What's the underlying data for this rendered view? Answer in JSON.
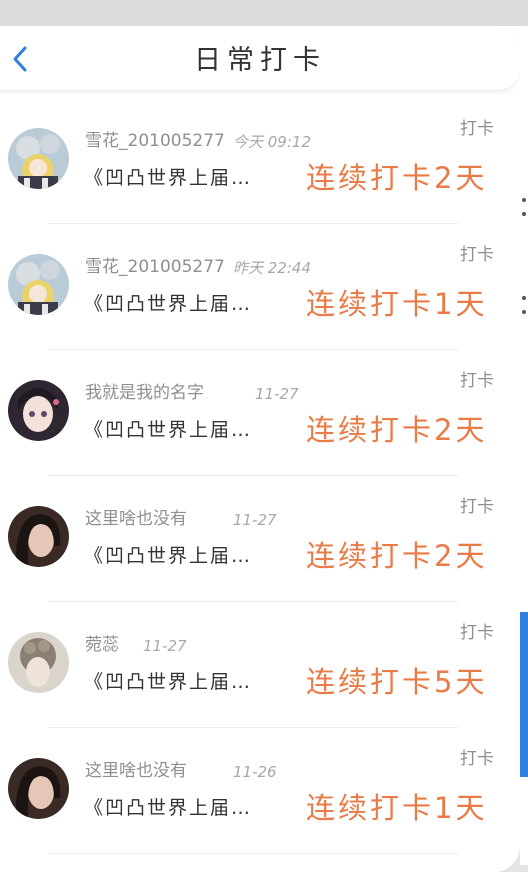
{
  "header": {
    "title": "日常打卡",
    "back_icon": "chevron-left-icon"
  },
  "colors": {
    "accent_blue": "#2f80e0",
    "streak_orange": "#e87b46",
    "meta_gray": "#8f8f8f"
  },
  "entries": [
    {
      "avatar": "anime-character-avatar",
      "name": "雪花_201005277",
      "time": "今天 09:12",
      "topic": "《凹凸世界上届…",
      "action": "打卡",
      "streak": "连续打卡2天"
    },
    {
      "avatar": "anime-character-avatar",
      "name": "雪花_201005277",
      "time": "昨天 22:44",
      "topic": "《凹凸世界上届…",
      "action": "打卡",
      "streak": "连续打卡1天"
    },
    {
      "avatar": "anime-girl-avatar",
      "name": "我就是我的名字",
      "time": "11-27",
      "topic": "《凹凸世界上届…",
      "action": "打卡",
      "streak": "连续打卡2天"
    },
    {
      "avatar": "dark-hair-photo-avatar",
      "name": "这里啥也没有",
      "time": "11-27",
      "topic": "《凹凸世界上届…",
      "action": "打卡",
      "streak": "连续打卡2天"
    },
    {
      "avatar": "braided-hair-photo-avatar",
      "name": "菀蕊",
      "time": "11-27",
      "topic": "《凹凸世界上届…",
      "action": "打卡",
      "streak": "连续打卡5天"
    },
    {
      "avatar": "dark-hair-photo-avatar",
      "name": "这里啥也没有",
      "time": "11-26",
      "topic": "《凹凸世界上届…",
      "action": "打卡",
      "streak": "连续打卡1天"
    }
  ]
}
